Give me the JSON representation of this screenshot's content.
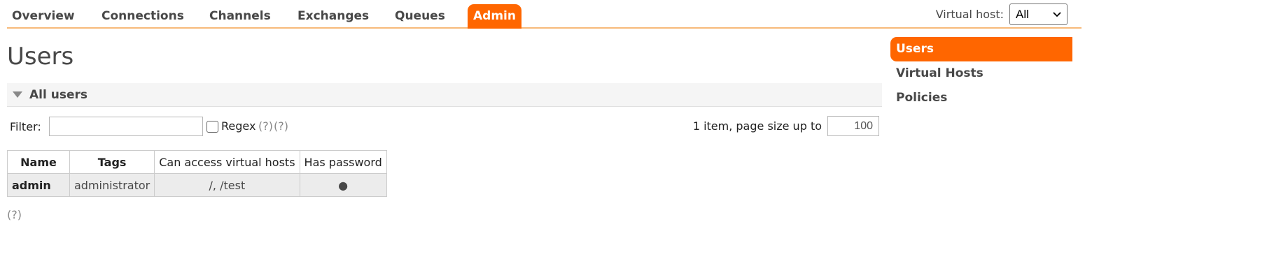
{
  "nav": {
    "tabs": [
      "Overview",
      "Connections",
      "Channels",
      "Exchanges",
      "Queues",
      "Admin"
    ],
    "active_tab": "Admin"
  },
  "vhost": {
    "label": "Virtual host:",
    "selected": "All"
  },
  "page": {
    "title": "Users"
  },
  "section": {
    "title": "All users"
  },
  "filter": {
    "label": "Filter:",
    "value": "",
    "regex_label": "Regex",
    "help1": "(?)",
    "help2": "(?)",
    "regex_checked": false
  },
  "pagination": {
    "summary": "1 item, page size up to",
    "page_size": "100"
  },
  "table": {
    "headers": [
      "Name",
      "Tags",
      "Can access virtual hosts",
      "Has password"
    ],
    "rows": [
      {
        "name": "admin",
        "tags": "administrator",
        "vhosts": "/, /test",
        "has_password": "●"
      }
    ]
  },
  "footer_help": "(?)",
  "sidebar": {
    "items": [
      "Users",
      "Virtual Hosts",
      "Policies"
    ],
    "active": "Users"
  },
  "colors": {
    "accent": "#ff6600",
    "nav_rule": "#f7ba7a",
    "text": "#484848"
  }
}
